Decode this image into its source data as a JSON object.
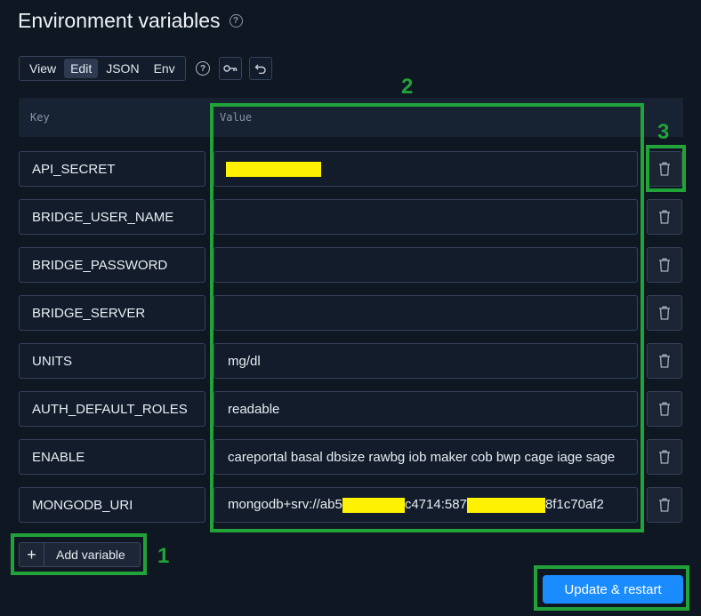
{
  "header": {
    "title": "Environment variables",
    "help_icon": "question-circle-icon"
  },
  "toolbar": {
    "modes": [
      "View",
      "Edit",
      "JSON",
      "Env"
    ],
    "active_mode": "Edit",
    "help_icon": "question-circle-icon",
    "key_icon": "key-icon",
    "undo_icon": "undo-icon"
  },
  "table": {
    "columns": {
      "key": "Key",
      "value": "Value"
    },
    "rows": [
      {
        "key": "API_SECRET",
        "value": "",
        "value_redacted": true
      },
      {
        "key": "BRIDGE_USER_NAME",
        "value": ""
      },
      {
        "key": "BRIDGE_PASSWORD",
        "value": ""
      },
      {
        "key": "BRIDGE_SERVER",
        "value": ""
      },
      {
        "key": "UNITS",
        "value": "mg/dl"
      },
      {
        "key": "AUTH_DEFAULT_ROLES",
        "value": "readable"
      },
      {
        "key": "ENABLE",
        "value": "careportal basal dbsize rawbg iob maker cob bwp cage iage sage"
      },
      {
        "key": "MONGODB_URI",
        "value_parts": [
          "mongodb+srv://ab5",
          "c4714:587",
          "8f1c70af2"
        ]
      }
    ],
    "delete_icon": "trash-icon"
  },
  "actions": {
    "add_plus": "+",
    "add_label": "Add variable",
    "update_label": "Update & restart"
  },
  "annotations": {
    "one": "1",
    "two": "2",
    "three": "3"
  },
  "colors": {
    "background": "#0f1722",
    "field": "#121c2a",
    "border": "#34425a",
    "primary": "#1a8cff",
    "annotation": "#21a33a",
    "redaction": "#fff200"
  }
}
